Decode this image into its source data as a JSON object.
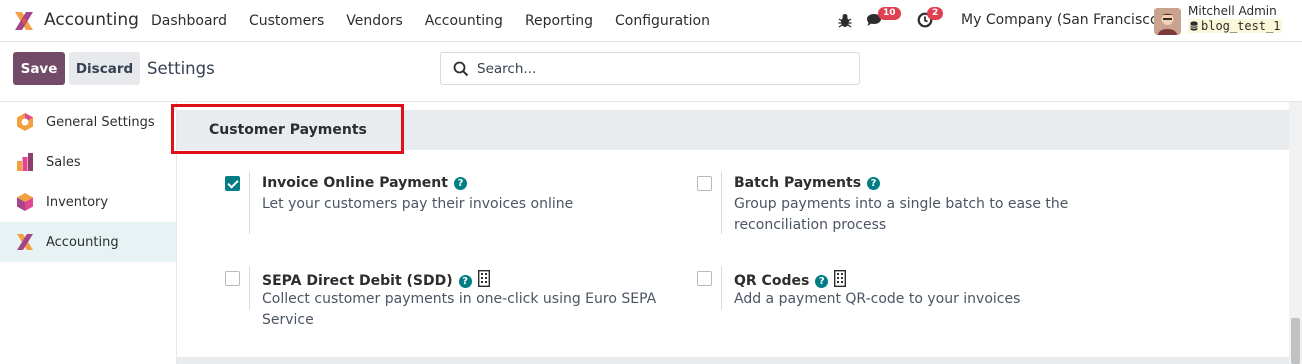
{
  "app": {
    "name": "Accounting"
  },
  "menu": [
    "Dashboard",
    "Customers",
    "Vendors",
    "Accounting",
    "Reporting",
    "Configuration"
  ],
  "systray": {
    "messages_count": "10",
    "activities_count": "2",
    "company": "My Company (San Francisco)",
    "user": "Mitchell Admin",
    "database": "blog_test_1"
  },
  "control": {
    "save_label": "Save",
    "discard_label": "Discard",
    "breadcrumb": "Settings",
    "search_placeholder": "Search..."
  },
  "sidebar": {
    "items": [
      {
        "label": "General Settings",
        "icon": "general-settings-icon"
      },
      {
        "label": "Sales",
        "icon": "sales-icon"
      },
      {
        "label": "Inventory",
        "icon": "inventory-icon"
      },
      {
        "label": "Accounting",
        "icon": "accounting-icon",
        "active": true
      }
    ]
  },
  "section": {
    "title": "Customer Payments",
    "settings": [
      {
        "title": "Invoice Online Payment",
        "desc": "Let your customers pay their invoices online",
        "checked": true
      },
      {
        "title": "Batch Payments",
        "desc": "Group payments into a single batch to ease the reconciliation process",
        "checked": false
      },
      {
        "title": "SEPA Direct Debit (SDD)",
        "desc": "Collect customer payments in one-click using Euro SEPA Service",
        "checked": false
      },
      {
        "title": "QR Codes",
        "desc": "Add a payment QR-code to your invoices",
        "checked": false
      }
    ]
  },
  "colors": {
    "brand": "#714b67",
    "accent": "#017e84",
    "highlight": "#e0101a",
    "badge": "#e04152"
  }
}
